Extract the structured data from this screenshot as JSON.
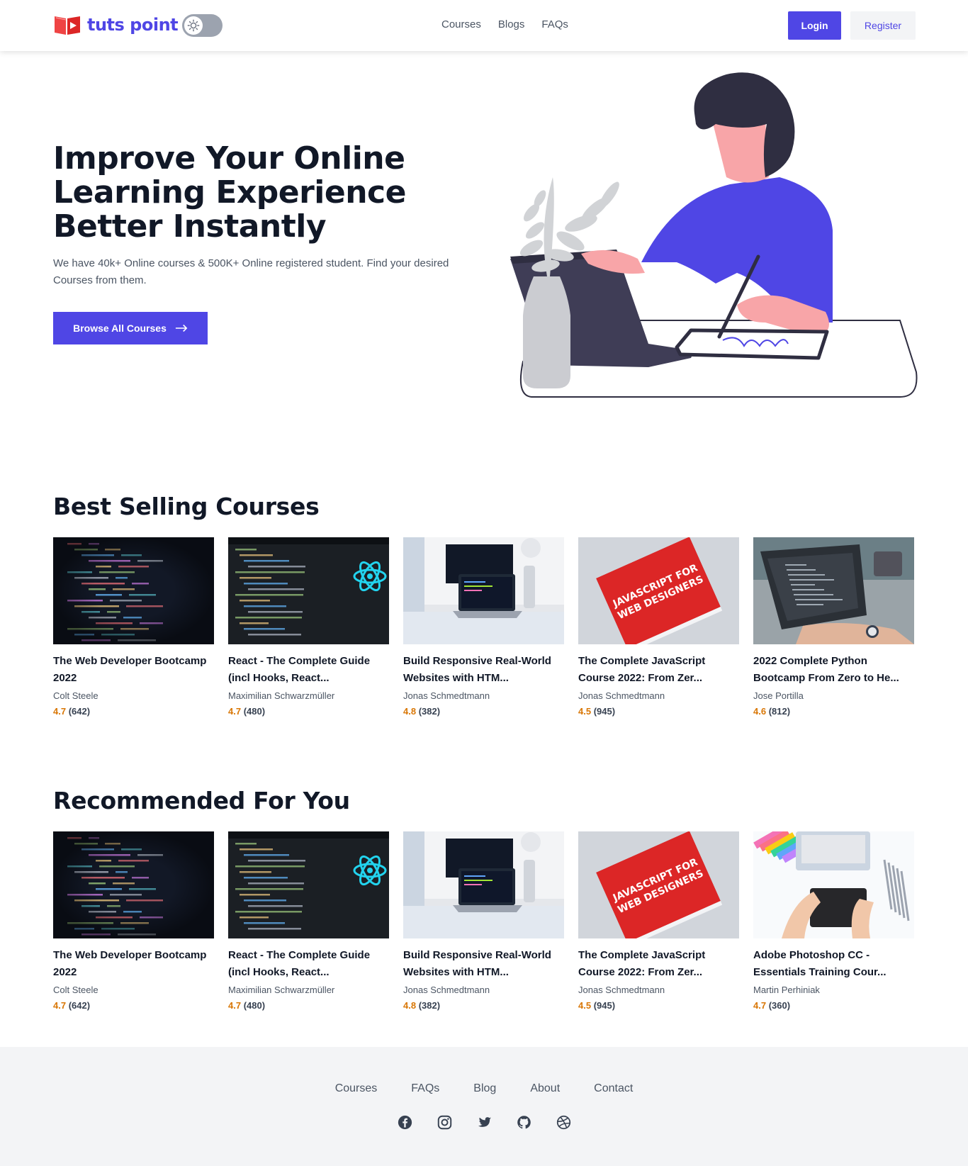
{
  "brand": {
    "name": "tuts point"
  },
  "nav": {
    "links": [
      "Courses",
      "Blogs",
      "FAQs"
    ],
    "login": "Login",
    "register": "Register"
  },
  "hero": {
    "title_lines": [
      "Improve Your Online",
      "Learning Experience",
      "Better Instantly"
    ],
    "subtitle": "We have 40k+ Online courses & 500K+ Online registered student. Find your desired Courses from them.",
    "cta": "Browse All Courses"
  },
  "best_selling": {
    "title": "Best Selling Courses",
    "courses": [
      {
        "title": "The Web Developer Bootcamp 2022",
        "author": "Colt Steele",
        "rating": "4.7",
        "reviews": "(642)",
        "thumb": "code-editor-dark"
      },
      {
        "title": "React - The Complete Guide (incl Hooks, React...",
        "author": "Maximilian Schwarzmüller",
        "rating": "4.7",
        "reviews": "(480)",
        "thumb": "react-logo-code"
      },
      {
        "title": "Build Responsive Real-World Websites with HTM...",
        "author": "Jonas Schmedtmann",
        "rating": "4.8",
        "reviews": "(382)",
        "thumb": "laptop-desk"
      },
      {
        "title": "The Complete JavaScript Course 2022: From Zer...",
        "author": "Jonas Schmedtmann",
        "rating": "4.5",
        "reviews": "(945)",
        "thumb": "js-book"
      },
      {
        "title": "2022 Complete Python Bootcamp From Zero to He...",
        "author": "Jose Portilla",
        "rating": "4.6",
        "reviews": "(812)",
        "thumb": "laptop-hands"
      }
    ]
  },
  "recommended": {
    "title": "Recommended For You",
    "courses": [
      {
        "title": "The Web Developer Bootcamp 2022",
        "author": "Colt Steele",
        "rating": "4.7",
        "reviews": "(642)",
        "thumb": "code-editor-dark"
      },
      {
        "title": "React - The Complete Guide (incl Hooks, React...",
        "author": "Maximilian Schwarzmüller",
        "rating": "4.7",
        "reviews": "(480)",
        "thumb": "react-logo-code"
      },
      {
        "title": "Build Responsive Real-World Websites with HTM...",
        "author": "Jonas Schmedtmann",
        "rating": "4.8",
        "reviews": "(382)",
        "thumb": "laptop-desk"
      },
      {
        "title": "The Complete JavaScript Course 2022: From Zer...",
        "author": "Jonas Schmedtmann",
        "rating": "4.5",
        "reviews": "(945)",
        "thumb": "js-book"
      },
      {
        "title": "Adobe Photoshop CC - Essentials Training Cour...",
        "author": "Martin Perhiniak",
        "rating": "4.7",
        "reviews": "(360)",
        "thumb": "design-tablet"
      }
    ]
  },
  "footer": {
    "links": [
      "Courses",
      "FAQs",
      "Blog",
      "About",
      "Contact"
    ],
    "social": [
      "facebook-icon",
      "instagram-icon",
      "twitter-icon",
      "github-icon",
      "dribbble-icon"
    ]
  },
  "colors": {
    "accent": "#4f46e5",
    "rating": "#d97706",
    "footer_bg": "#f3f4f6"
  }
}
